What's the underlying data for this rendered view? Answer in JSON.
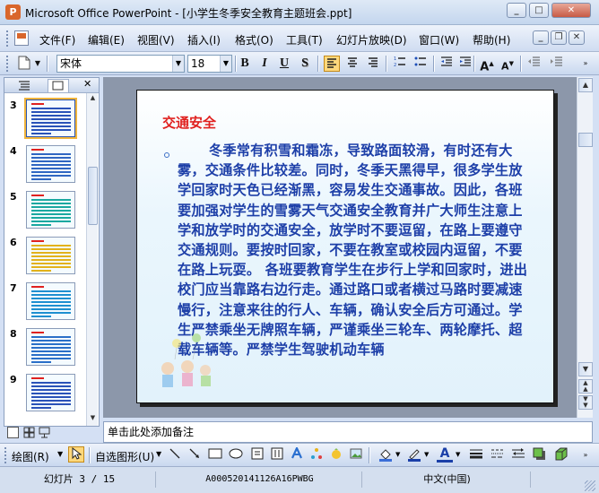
{
  "window": {
    "title": "Microsoft Office PowerPoint - [小学生冬季安全教育主题班会.ppt]",
    "app_icon": "P"
  },
  "menu": [
    "文件(F)",
    "编辑(E)",
    "视图(V)",
    "插入(I)",
    "格式(O)",
    "工具(T)",
    "幻灯片放映(D)",
    "窗口(W)",
    "帮助(H)"
  ],
  "toolbar": {
    "font_name": "宋体",
    "font_size": "18",
    "bold": "B",
    "italic": "I",
    "underline": "U",
    "shadow": "S"
  },
  "thumbnails": [
    {
      "num": "3",
      "selected": true,
      "accent": "#2a52b8"
    },
    {
      "num": "4",
      "selected": false,
      "accent": "#2f66c2"
    },
    {
      "num": "5",
      "selected": false,
      "accent": "#1aa8a0"
    },
    {
      "num": "6",
      "selected": false,
      "accent": "#e2b21b"
    },
    {
      "num": "7",
      "selected": false,
      "accent": "#1e8fd0"
    },
    {
      "num": "8",
      "selected": false,
      "accent": "#2a6fc8"
    },
    {
      "num": "9",
      "selected": false,
      "accent": "#2a52b8"
    }
  ],
  "slide": {
    "title": "交通安全",
    "body": "冬季常有积雪和霜冻，导致路面较滑，有时还有大雾，交通条件比较差。同时，冬季天黑得早，很多学生放学回家时天色已经渐黑，容易发生交通事故。因此，各班要加强对学生的雪雾天气交通安全教育并广大师生注意上学和放学时的交通安全，放学时不要逗留，在路上要遵守交通规则。要按时回家，不要在教室或校园内逗留，不要在路上玩耍。  各班要教育学生在步行上学和回家时，进出校门应当靠路右边行走。通过路口或者横过马路时要减速慢行，注意来往的行人、车辆，确认安全后方可通过。学生严禁乘坐无牌照车辆，严谨乘坐三轮车、两轮摩托、超载车辆等。严禁学生驾驶机动车辆",
    "title_color": "#e0211f",
    "body_color": "#1d3fa8"
  },
  "notes_placeholder": "单击此处添加备注",
  "drawbar": {
    "draw_label": "绘图(R)",
    "autoshape_label": "自选图形(U)"
  },
  "status": {
    "slide_info": "幻灯片 3 / 15",
    "template": "A000520141126A16PWBG",
    "language": "中文(中国)"
  }
}
